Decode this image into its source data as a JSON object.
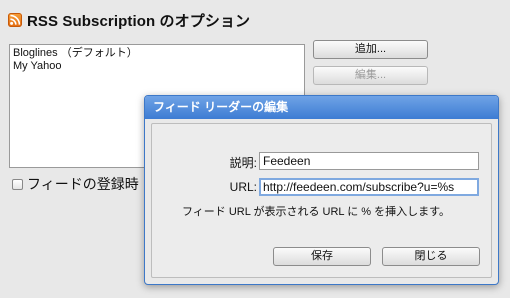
{
  "header": {
    "title": "RSS Subscription のオプション"
  },
  "readers": [
    {
      "label": "Bloglines （デフォルト）"
    },
    {
      "label": "My Yahoo"
    }
  ],
  "side_buttons": {
    "add": "追加...",
    "edit": "編集..."
  },
  "checkbox": {
    "label": "フィードの登録時"
  },
  "dialog": {
    "title": "フィード リーダーの編集",
    "description_label": "説明:",
    "description_value": "Feedeen",
    "url_label": "URL:",
    "url_value": "http://feedeen.com/subscribe?u=%s",
    "hint": "フィード URL が表示される URL に % を挿入します。",
    "save": "保存",
    "close": "閉じる"
  },
  "colors": {
    "titlebar": "#3d7cd3",
    "focus_ring": "#7fa9e0",
    "rss_orange": "#f28a25"
  },
  "icons": {
    "header": "rss-feed-icon"
  }
}
